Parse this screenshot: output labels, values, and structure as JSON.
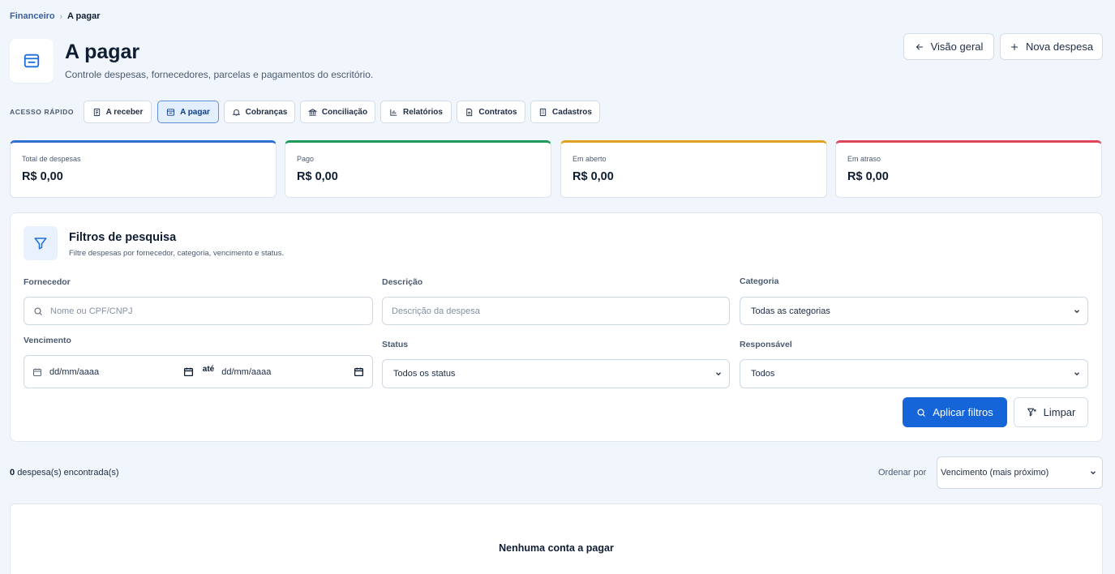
{
  "breadcrumb": {
    "parent": "Financeiro",
    "separator": "›",
    "current": "A pagar"
  },
  "header": {
    "title": "A pagar",
    "subtitle": "Controle despesas, fornecedores, parcelas e pagamentos do escritório.",
    "icon": "wallet-icon",
    "overview_button": "Visão geral",
    "new_button": "Nova despesa"
  },
  "quick_access": {
    "label": "ACESSO RÁPIDO",
    "items": [
      {
        "label": "A receber",
        "icon": "receipt-icon",
        "active": false
      },
      {
        "label": "A pagar",
        "icon": "wallet-icon",
        "active": true
      },
      {
        "label": "Cobranças",
        "icon": "bell-icon",
        "active": false
      },
      {
        "label": "Conciliação",
        "icon": "bank-icon",
        "active": false
      },
      {
        "label": "Relatórios",
        "icon": "bar-chart-icon",
        "active": false
      },
      {
        "label": "Contratos",
        "icon": "document-icon",
        "active": false
      },
      {
        "label": "Cadastros",
        "icon": "building-icon",
        "active": false
      }
    ]
  },
  "stats": [
    {
      "label": "Total de despesas",
      "value": "R$ 0,00",
      "color": "#2f6fd0"
    },
    {
      "label": "Pago",
      "value": "R$ 0,00",
      "color": "#1f9a5a"
    },
    {
      "label": "Em aberto",
      "value": "R$ 0,00",
      "color": "#e0a020"
    },
    {
      "label": "Em atraso",
      "value": "R$ 0,00",
      "color": "#e0455a"
    }
  ],
  "filters": {
    "title": "Filtros de pesquisa",
    "subtitle": "Filtre despesas por fornecedor, categoria, vencimento e status.",
    "fornecedor": {
      "label": "Fornecedor",
      "placeholder": "Nome ou CPF/CNPJ"
    },
    "descricao": {
      "label": "Descrição",
      "placeholder": "Descrição da despesa"
    },
    "categoria": {
      "label": "Categoria",
      "value": "Todas as categorias"
    },
    "vencimento": {
      "label": "Vencimento",
      "from_placeholder": "dd/mm/aaaa",
      "between": "até",
      "to_placeholder": "dd/mm/aaaa"
    },
    "status": {
      "label": "Status",
      "value": "Todos os status"
    },
    "responsavel": {
      "label": "Responsável",
      "value": "Todos"
    },
    "apply_button": "Aplicar filtros",
    "clear_button": "Limpar"
  },
  "results": {
    "count": "0",
    "count_suffix": "despesa(s) encontrada(s)",
    "sort_label": "Ordenar por",
    "sort_value": "Vencimento (mais próximo)"
  },
  "empty_state": {
    "title": "Nenhuma conta a pagar"
  },
  "colors": {
    "primary": "#1565d8",
    "background": "#f1f6fc",
    "active_tab_bg": "#e3efff"
  }
}
